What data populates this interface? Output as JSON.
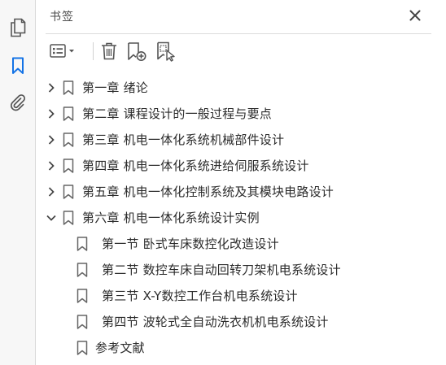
{
  "panel": {
    "title": "书签"
  },
  "rail": {
    "icons": [
      "pages-icon",
      "bookmark-icon",
      "attachment-icon"
    ],
    "active_color": "#1473e6"
  },
  "toolbar": {
    "icons": [
      "options-menu-icon",
      "delete-icon",
      "new-bookmark-icon",
      "bookmark-from-selection-icon"
    ]
  },
  "bookmarks": [
    {
      "label": "第一章  绪论",
      "level": 0,
      "state": "collapsed"
    },
    {
      "label": "第二章  课程设计的一般过程与要点",
      "level": 0,
      "state": "collapsed"
    },
    {
      "label": "第三章  机电一体化系统机械部件设计",
      "level": 0,
      "state": "collapsed"
    },
    {
      "label": "第四章  机电一体化系统进给伺服系统设计",
      "level": 0,
      "state": "collapsed"
    },
    {
      "label": "第五章  机电一体化控制系统及其模块电路设计",
      "level": 0,
      "state": "collapsed"
    },
    {
      "label": "第六章  机电一体化系统设计实例",
      "level": 0,
      "state": "expanded"
    },
    {
      "label": "第一节  卧式车床数控化改造设计",
      "level": 1,
      "state": "leaf"
    },
    {
      "label": "第二节  数控车床自动回转刀架机电系统设计",
      "level": 1,
      "state": "leaf"
    },
    {
      "label": "第三节  X-Y数控工作台机电系统设计",
      "level": 1,
      "state": "leaf"
    },
    {
      "label": "第四节  波轮式全自动洗衣机机电系统设计",
      "level": 1,
      "state": "leaf"
    },
    {
      "label": "参考文献",
      "level": 0,
      "state": "leaf"
    }
  ]
}
